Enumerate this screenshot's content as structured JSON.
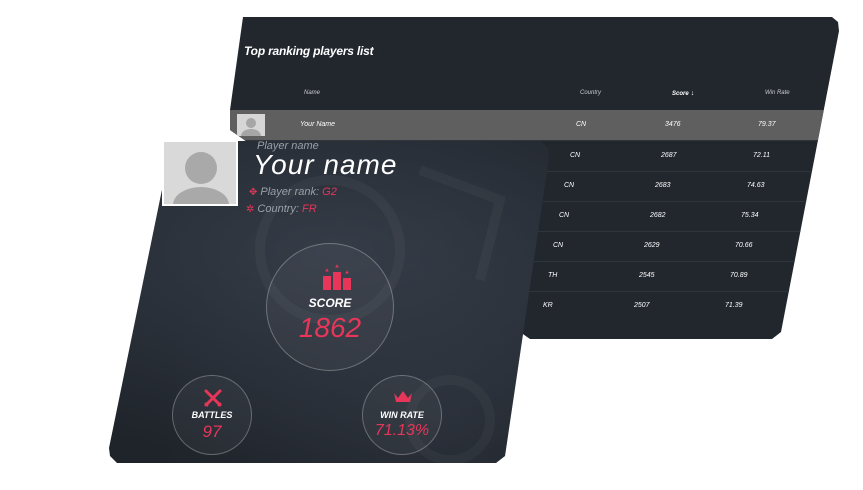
{
  "ranking": {
    "title": "Top ranking players list",
    "headers": {
      "name": "Name",
      "country": "Country",
      "score": "Score",
      "win_rate": "Win Rate"
    },
    "rows": [
      {
        "name": "Your Name",
        "country": "CN",
        "score": "3476",
        "win_rate": "79.37"
      },
      {
        "name": "",
        "country": "CN",
        "score": "2687",
        "win_rate": "72.11"
      },
      {
        "name": "",
        "country": "CN",
        "score": "2683",
        "win_rate": "74.63"
      },
      {
        "name": "",
        "country": "CN",
        "score": "2682",
        "win_rate": "75.34"
      },
      {
        "name": "",
        "country": "CN",
        "score": "2629",
        "win_rate": "70.66"
      },
      {
        "name": "",
        "country": "TH",
        "score": "2545",
        "win_rate": "70.89"
      },
      {
        "name": "",
        "country": "KR",
        "score": "2507",
        "win_rate": "71.39"
      }
    ]
  },
  "player": {
    "label": "Player name",
    "name": "Your name",
    "rank_label": "Player rank: ",
    "rank_value": "G2",
    "country_label": "Country: ",
    "country_value": "FR"
  },
  "stats": {
    "score_label": "SCORE",
    "score_value": "1862",
    "battles_label": "BATTLES",
    "battles_value": "97",
    "winrate_label": "WIN RATE",
    "winrate_value": "71.13%"
  },
  "colors": {
    "accent": "#e8355a",
    "card_bg": "#22272e",
    "highlight_row": "#5f5f5f"
  },
  "icons": [
    "avatar-placeholder",
    "sort-down-arrow",
    "rank-icon",
    "country-icon",
    "podium-icon",
    "crossed-swords-icon",
    "crown-icon"
  ]
}
